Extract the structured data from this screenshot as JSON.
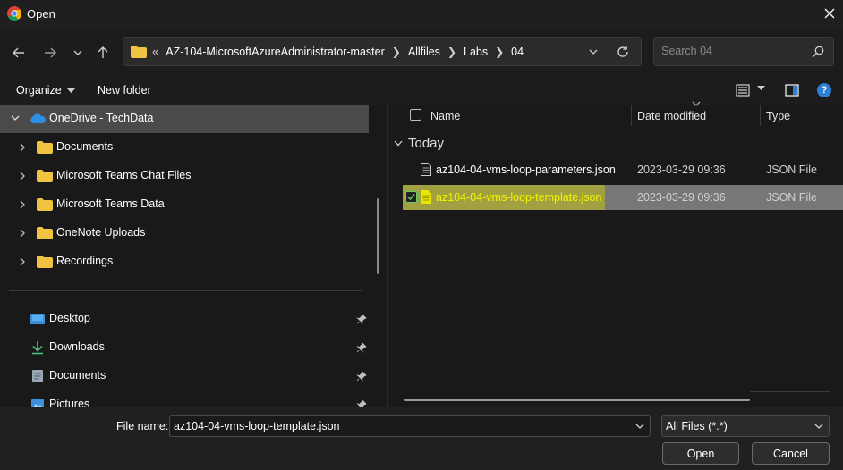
{
  "window": {
    "title": "Open"
  },
  "address": {
    "breadcrumbs": [
      "AZ-104-MicrosoftAzureAdministrator-master",
      "Allfiles",
      "Labs",
      "04"
    ],
    "overflow_glyph": "«"
  },
  "search": {
    "placeholder": "Search 04"
  },
  "toolbar": {
    "organize_label": "Organize",
    "new_folder_label": "New folder"
  },
  "sidebar": {
    "onedrive_label": "OneDrive - TechData",
    "folders": [
      {
        "label": "Documents"
      },
      {
        "label": "Microsoft Teams Chat Files"
      },
      {
        "label": "Microsoft Teams Data"
      },
      {
        "label": "OneNote Uploads"
      },
      {
        "label": "Recordings"
      }
    ],
    "quick_access": [
      {
        "label": "Desktop",
        "icon": "desktop-icon"
      },
      {
        "label": "Downloads",
        "icon": "download-icon"
      },
      {
        "label": "Documents",
        "icon": "document-icon"
      },
      {
        "label": "Pictures",
        "icon": "pictures-icon"
      }
    ]
  },
  "file_list": {
    "columns": {
      "name": "Name",
      "date": "Date modified",
      "type": "Type"
    },
    "group_label": "Today",
    "files": [
      {
        "name": "az104-04-vms-loop-parameters.json",
        "date": "2023-03-29 09:36",
        "type": "JSON File",
        "selected": false
      },
      {
        "name": "az104-04-vms-loop-template.json",
        "date": "2023-03-29 09:36",
        "type": "JSON File",
        "selected": true
      }
    ]
  },
  "bottom": {
    "file_name_label": "File name:",
    "file_name_value": "az104-04-vms-loop-template.json",
    "file_type_value": "All Files (*.*)",
    "open_label": "Open",
    "cancel_label": "Cancel"
  },
  "colors": {
    "folder": "#f0c341",
    "onedrive": "#2b8fe6",
    "highlight": "#d4d400",
    "selected_row": "#777777",
    "help": "#2f7fd5"
  }
}
